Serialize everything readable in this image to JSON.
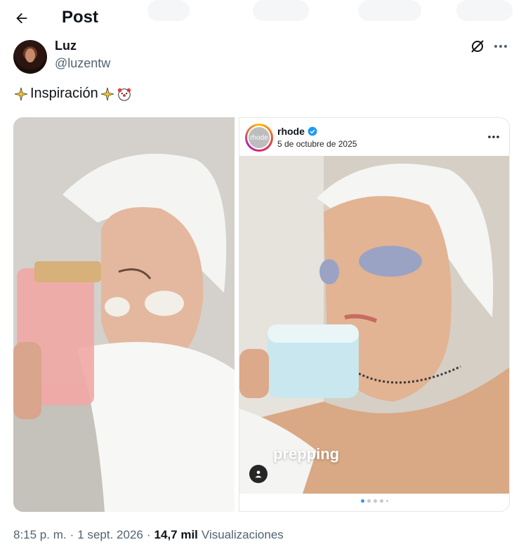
{
  "header": {
    "title": "Post"
  },
  "user": {
    "name": "Luz",
    "handle": "@luzentw"
  },
  "post": {
    "text": "Inspiración"
  },
  "embed": {
    "account": "rhode",
    "avatar_text": "rhode",
    "date": "5 de octubre de 2025",
    "overlay_text": "prepping"
  },
  "meta": {
    "time": "8:15 p. m.",
    "sep1": "·",
    "date": "1 sept. 2026",
    "sep2": "·",
    "views_count": "14,7 mil",
    "views_label": "Visualizaciones"
  },
  "colors": {
    "accent": "#1d9bf0",
    "secondary_text": "#536471",
    "primary_text": "#0f1419"
  }
}
